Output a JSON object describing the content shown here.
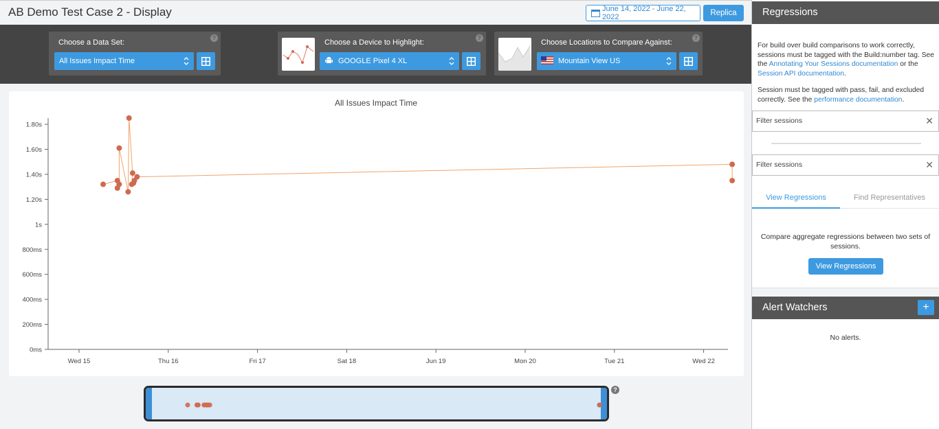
{
  "header": {
    "title": "AB Demo Test Case 2 - Display",
    "date_range": "June 14, 2022 - June 22, 2022",
    "replica_label": "Replica"
  },
  "controls": {
    "dataset": {
      "label": "Choose a Data Set:",
      "value": "All Issues Impact Time",
      "help": "?"
    },
    "device": {
      "label": "Choose a Device to Highlight:",
      "value": "GOOGLE Pixel 4 XL",
      "icon": "android-icon",
      "help": "?"
    },
    "location": {
      "label": "Choose Locations to Compare Against:",
      "value": "Mountain View US",
      "icon": "us-flag-icon",
      "help": "?"
    }
  },
  "chart_data": {
    "type": "line",
    "title": "All Issues Impact Time",
    "xlabel": "",
    "ylabel": "",
    "y_ticks": [
      "0ms",
      "200ms",
      "400ms",
      "600ms",
      "800ms",
      "1s",
      "1.20s",
      "1.40s",
      "1.60s",
      "1.80s"
    ],
    "ylim": [
      0,
      1.85
    ],
    "x_ticks": [
      "Wed 15",
      "Thu 16",
      "Fri 17",
      "Sat 18",
      "Jun 19",
      "Mon 20",
      "Tue 21",
      "Wed 22"
    ],
    "x_unit": "days since Wed 15",
    "series": [
      {
        "color": "#f0a46b",
        "marker_color": "#cf6a50",
        "points": [
          [
            0.27,
            1.32
          ],
          [
            0.43,
            1.35
          ],
          [
            0.43,
            1.29
          ],
          [
            0.45,
            1.32
          ],
          [
            0.45,
            1.61
          ],
          [
            0.55,
            1.26
          ],
          [
            0.56,
            1.85
          ],
          [
            0.6,
            1.41
          ],
          [
            0.59,
            1.32
          ],
          [
            0.61,
            1.33
          ],
          [
            0.62,
            1.35
          ],
          [
            0.65,
            1.38
          ],
          [
            7.32,
            1.48
          ],
          [
            7.32,
            1.35
          ]
        ]
      }
    ]
  },
  "brush": {
    "help": "?"
  },
  "sidebar": {
    "regressions_title": "Regressions",
    "para1_a": "For build over build comparisons to work correctly, sessions must be tagged with the Build:number tag. See the ",
    "link1": "Annotating Your Sessions documentation",
    "para1_b": " or the ",
    "link2": "Session API documentation",
    "para1_c": ".",
    "para2_a": "Session must be tagged with pass, fail, and excluded correctly. See the ",
    "link3": "performance documentation",
    "para2_b": ".",
    "filter1_placeholder": "Filter sessions",
    "filter2_placeholder": "Filter sessions",
    "tab_view": "View Regressions",
    "tab_find": "Find Representatives",
    "compare_text": "Compare aggregate regressions between two sets of sessions.",
    "view_button": "View Regressions",
    "alert_title": "Alert Watchers",
    "add_label": "+",
    "no_alerts": "No alerts."
  }
}
